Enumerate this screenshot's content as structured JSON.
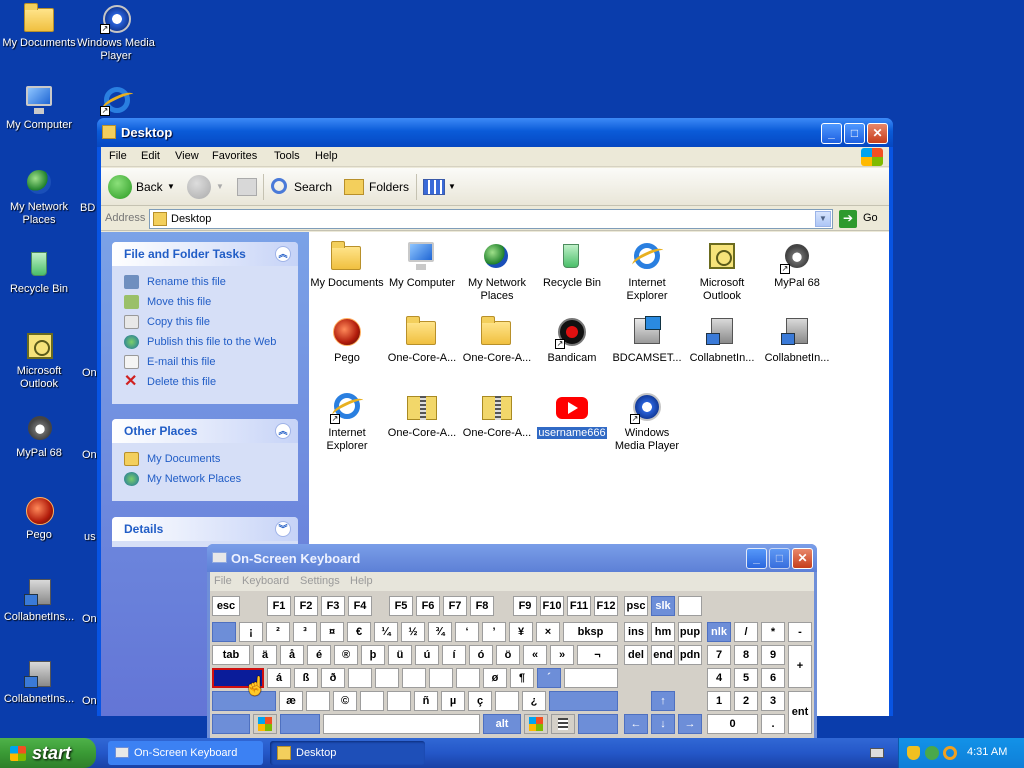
{
  "desktop": {
    "icons": [
      {
        "label": "My Documents",
        "icon": "folder-icon"
      },
      {
        "label": "Windows Media Player",
        "icon": "media-player-icon"
      },
      {
        "label": "My Computer",
        "icon": "computer-icon"
      },
      {
        "label": "My Network Places",
        "icon": "network-places-icon"
      },
      {
        "label": "Recycle Bin",
        "icon": "recycle-bin-icon"
      },
      {
        "label": "Microsoft Outlook",
        "icon": "outlook-icon"
      },
      {
        "label": "MyPal 68",
        "icon": "mypal-icon"
      },
      {
        "label": "Pego",
        "icon": "pego-icon"
      },
      {
        "label": "CollabnetIns...",
        "icon": "setup-icon"
      },
      {
        "label": "CollabnetIns...",
        "icon": "setup-icon"
      }
    ],
    "partial": [
      "BD",
      "On",
      "On",
      "us",
      "On",
      "On"
    ]
  },
  "explorer": {
    "title": "Desktop",
    "menu": [
      "File",
      "Edit",
      "View",
      "Favorites",
      "Tools",
      "Help"
    ],
    "toolbar": {
      "back": "Back",
      "search": "Search",
      "folders": "Folders"
    },
    "address_label": "Address",
    "address_value": "Desktop",
    "go": "Go",
    "panels": {
      "file_tasks": {
        "title": "File and Folder Tasks",
        "items": [
          "Rename this file",
          "Move this file",
          "Copy this file",
          "Publish this file to the Web",
          "E-mail this file",
          "Delete this file"
        ]
      },
      "other_places": {
        "title": "Other Places",
        "items": [
          "My Documents",
          "My Network Places"
        ]
      },
      "details": {
        "title": "Details"
      }
    },
    "files": [
      {
        "label": "My Documents",
        "icon": "folder-icon"
      },
      {
        "label": "My Computer",
        "icon": "computer-icon"
      },
      {
        "label": "My Network Places",
        "icon": "network-places-icon"
      },
      {
        "label": "Recycle Bin",
        "icon": "recycle-bin-icon"
      },
      {
        "label": "Internet Explorer",
        "icon": "internet-explorer-icon"
      },
      {
        "label": "Microsoft Outlook",
        "icon": "outlook-icon"
      },
      {
        "label": "MyPal 68",
        "icon": "mypal-icon"
      },
      {
        "label": "Pego",
        "icon": "pego-icon"
      },
      {
        "label": "One-Core-A...",
        "icon": "folder-icon"
      },
      {
        "label": "One-Core-A...",
        "icon": "folder-icon"
      },
      {
        "label": "Bandicam",
        "icon": "bandicam-icon"
      },
      {
        "label": "BDCAMSET...",
        "icon": "setup-icon"
      },
      {
        "label": "CollabnetIn...",
        "icon": "setup-icon"
      },
      {
        "label": "CollabnetIn...",
        "icon": "setup-icon"
      },
      {
        "label": "Internet Explorer",
        "icon": "internet-explorer-icon"
      },
      {
        "label": "One-Core-A...",
        "icon": "zip-folder-icon"
      },
      {
        "label": "One-Core-A...",
        "icon": "zip-folder-icon"
      },
      {
        "label": "username666",
        "icon": "youtube-icon",
        "selected": true
      },
      {
        "label": "Windows Media Player",
        "icon": "media-player-icon"
      }
    ]
  },
  "osk": {
    "title": "On-Screen Keyboard",
    "menu": [
      "File",
      "Keyboard",
      "Settings",
      "Help"
    ],
    "row1": [
      "esc",
      "F1",
      "F2",
      "F3",
      "F4",
      "F5",
      "F6",
      "F7",
      "F8",
      "F9",
      "F10",
      "F11",
      "F12",
      "psc",
      "slk",
      ""
    ],
    "row2": [
      "",
      "¡",
      "²",
      "³",
      "¤",
      "€",
      "¼",
      "½",
      "¾",
      "‘",
      "’",
      "¥",
      "×",
      "bksp",
      "ins",
      "hm",
      "pup",
      "nlk",
      "/",
      "*",
      "-"
    ],
    "row3": [
      "tab",
      "ä",
      "å",
      "é",
      "®",
      "þ",
      "ü",
      "ú",
      "í",
      "ó",
      "ö",
      "«",
      "»",
      "¬",
      "del",
      "end",
      "pdn",
      "7",
      "8",
      "9",
      "+"
    ],
    "row4": [
      "",
      "á",
      "ß",
      "ð",
      "",
      "",
      "",
      "",
      "",
      "ø",
      "¶",
      "´",
      "",
      "4",
      "5",
      "6"
    ],
    "row5": [
      "",
      "æ",
      "",
      "©",
      "",
      "",
      "ñ",
      "µ",
      "ç",
      "",
      "¿",
      "",
      "1",
      "2",
      "3",
      "ent"
    ],
    "row6": [
      "",
      "",
      "",
      "",
      "alt",
      "",
      "",
      "",
      "",
      "",
      "",
      "0",
      "."
    ]
  },
  "taskbar": {
    "start": "start",
    "tasks": [
      "On-Screen Keyboard",
      "Desktop"
    ],
    "clock": "4:31 AM"
  }
}
